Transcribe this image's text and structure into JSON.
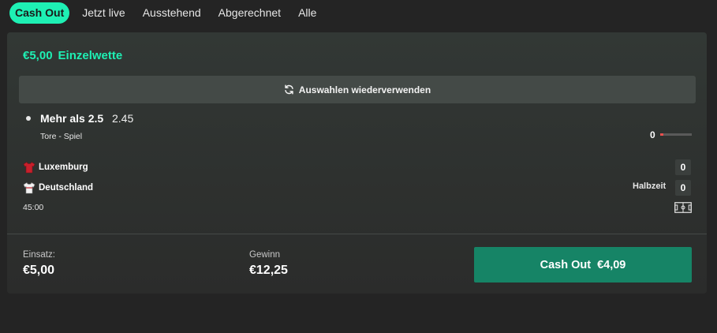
{
  "tabs": [
    {
      "label": "Cash Out",
      "active": true
    },
    {
      "label": "Jetzt live"
    },
    {
      "label": "Ausstehend"
    },
    {
      "label": "Abgerechnet"
    },
    {
      "label": "Alle"
    }
  ],
  "bet": {
    "stake_amount": "€5,00",
    "type": "Einzelwette",
    "reuse_label": "Auswahlen wiederverwenden",
    "selection": {
      "name": "Mehr als 2.5",
      "odds": "2.45",
      "market": "Tore - Spiel",
      "goals": "0",
      "goal_progress_fraction": 0.1
    },
    "match": {
      "home": {
        "name": "Luxemburg",
        "score": "0",
        "shirt_color": "#c8202c"
      },
      "away": {
        "name": "Deutschland",
        "score": "0",
        "shirt_color": "#f2f2f2"
      },
      "period": "Halbzeit",
      "clock": "45:00"
    },
    "footer": {
      "stake_label": "Einsatz:",
      "stake_value": "€5,00",
      "win_label": "Gewinn",
      "win_value": "€12,25",
      "cashout_label": "Cash Out",
      "cashout_value": "€4,09"
    }
  },
  "colors": {
    "accent": "#1ef0b4",
    "cashout_button": "#168466",
    "progress": "#e8504f"
  },
  "icons": [
    "refresh-icon",
    "shirt-icon",
    "pitch-icon"
  ]
}
